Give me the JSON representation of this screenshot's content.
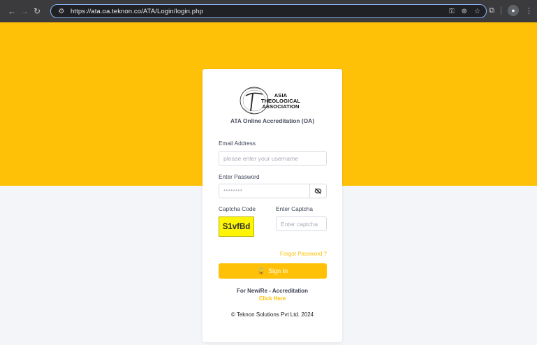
{
  "browser": {
    "url": "https://ata.oa.teknon.co/ATA/Login/login.php",
    "icons": [
      "back-icon",
      "forward-icon",
      "reload-icon",
      "site-info-icon",
      "password-key-icon",
      "install-icon",
      "bookmark-star-icon",
      "extensions-icon",
      "profile-icon",
      "menu-icon"
    ]
  },
  "colors": {
    "accent": "#fec107",
    "captcha_bg": "#fdf406",
    "background": "#f4f5f8"
  },
  "logo": {
    "lines": [
      "ASIA",
      "THEOLOGICAL",
      "ASSOCIATION"
    ]
  },
  "app_title": "ATA Online Accreditation (OA)",
  "form": {
    "email_label": "Email Address",
    "email_placeholder": "please enter your username",
    "password_label": "Enter Password",
    "password_value": "********",
    "captcha_label": "Captcha Code",
    "captcha_code": "S1vfBd",
    "enter_captcha_label": "Enter Captcha",
    "enter_captcha_placeholder": "Enter captcha",
    "forgot_password": "Forgot Password ?",
    "sign_in": "Sign In"
  },
  "footer": {
    "new_accreditation": "For New/Re - Accreditation",
    "click_here": "Click Here",
    "copyright": "© Teknon Solutions Pvt Ltd. 2024"
  }
}
